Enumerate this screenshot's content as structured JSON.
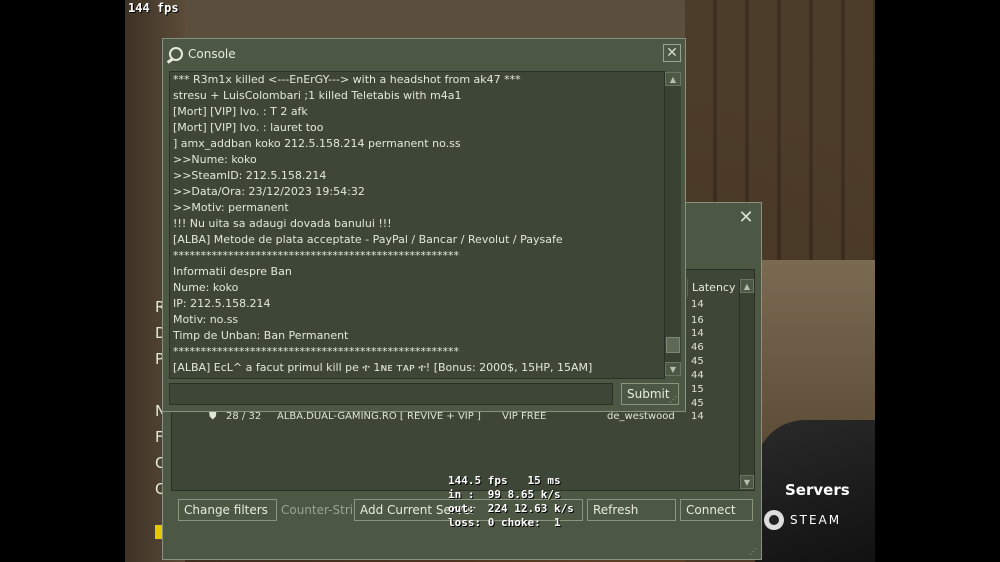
{
  "hud": {
    "fps": "144 fps"
  },
  "game_menu": {
    "letters": [
      "R",
      "D",
      "P",
      "N",
      "F",
      "C",
      "Q"
    ]
  },
  "brand": {
    "servers": "Servers",
    "steam": "STEAM"
  },
  "server_browser": {
    "column_latency": "Latency",
    "latencies": [
      "14",
      "16",
      "14",
      "46",
      "45",
      "44",
      "15",
      "45"
    ],
    "row": {
      "players": "28 / 32",
      "name": "ALBA.DUAL-GAMING.RO [ REVIVE + VIP ]",
      "tags": "VIP FREE",
      "map": "de_westwood",
      "latency": "14"
    },
    "buttons": {
      "change_filters": "Change filters",
      "game": "Counter-Stri...",
      "add_server": "Add Current Server",
      "refresh": "Refresh",
      "connect": "Connect"
    }
  },
  "netgraph": "144.5 fps   15 ms\nin :  99 8.65 k/s\nout:  224 12.63 k/s\nloss: 0 choke:  1",
  "console": {
    "title": "Console",
    "submit_label": "Submit",
    "input_value": "",
    "lines": [
      "*** R3m1x killed <---EnErGY---> with a headshot from ak47 ***",
      "stresu + LuisColombari ;1 killed Teletabis with m4a1",
      "[Mort] [VIP] Ivo. : T 2 afk",
      "[Mort] [VIP] Ivo. : lauret too",
      "] amx_addban koko 212.5.158.214  permanent no.ss",
      ">>Nume: koko",
      ">>SteamID: 212.5.158.214",
      ">>Data/Ora: 23/12/2023 19:54:32",
      ">>Motiv: permanent",
      "!!! Nu uita sa adaugi dovada banului !!!",
      "[ALBA] Metode de plata acceptate - PayPal / Bancar / Revolut / Paysafe",
      "****************************************************",
      "Informatii despre Ban",
      "Nume: koko",
      "IP: 212.5.158.214",
      "Motiv: no.ss",
      "Timp de Unban: Ban Permanent",
      "****************************************************",
      "[ALBA] EcL^ a facut primul kill pe ተ 1ɴᴇ ᴛᴀᴘ ተ! [Bonus: 2000$, 15HP, 15AM]"
    ]
  }
}
